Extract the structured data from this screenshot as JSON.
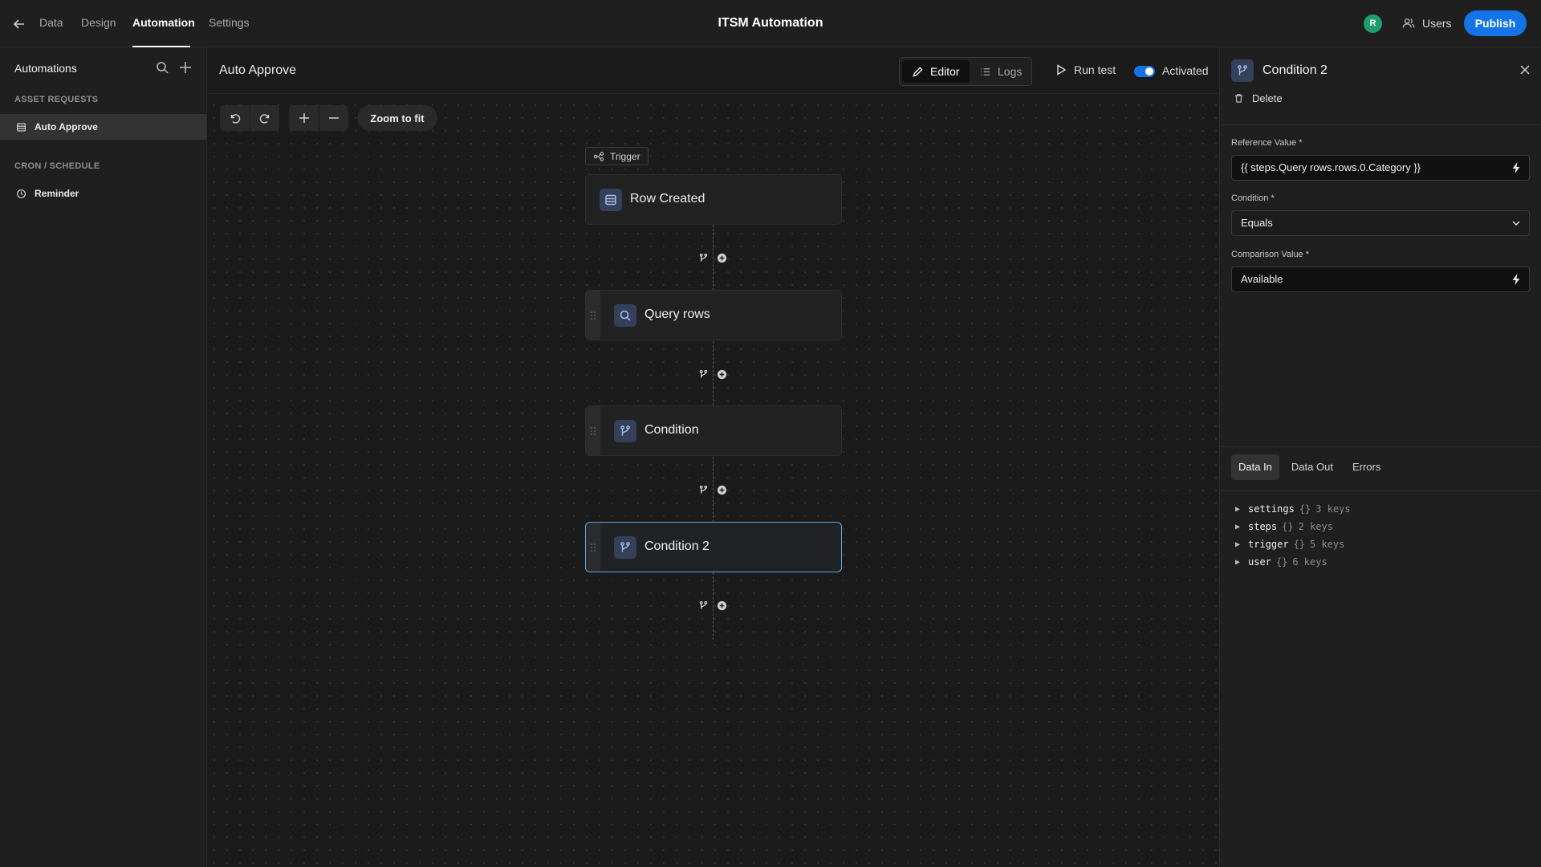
{
  "nav": {
    "tabs": [
      {
        "label": "Data"
      },
      {
        "label": "Design"
      },
      {
        "label": "Automation"
      },
      {
        "label": "Settings"
      }
    ],
    "app_title": "ITSM Automation",
    "avatar_initial": "R",
    "users_label": "Users",
    "publish_label": "Publish",
    "accent_color": "#1473e6"
  },
  "sidebar": {
    "title": "Automations",
    "sections": [
      {
        "label": "ASSET REQUESTS",
        "items": [
          {
            "label": "Auto Approve",
            "icon": "table-icon",
            "active": true
          }
        ]
      },
      {
        "label": "CRON / SCHEDULE",
        "items": [
          {
            "label": "Reminder",
            "icon": "clock-icon",
            "active": false
          }
        ]
      }
    ]
  },
  "canvas": {
    "automation_name": "Auto Approve",
    "editor_label": "Editor",
    "logs_label": "Logs",
    "run_test_label": "Run test",
    "activated_label": "Activated",
    "activated": true,
    "zoom_to_fit_label": "Zoom to fit",
    "trigger_chip_label": "Trigger",
    "nodes": [
      {
        "label": "Row Created",
        "icon": "table-icon",
        "selected": false
      },
      {
        "label": "Query rows",
        "icon": "search-icon",
        "selected": false
      },
      {
        "label": "Condition",
        "icon": "branch-icon",
        "selected": false
      },
      {
        "label": "Condition 2",
        "icon": "branch-icon",
        "selected": true
      }
    ]
  },
  "panel": {
    "title": "Condition 2",
    "delete_label": "Delete",
    "fields": {
      "reference_label": "Reference Value *",
      "reference_value": "{{ steps.Query rows.rows.0.Category }}",
      "condition_label": "Condition *",
      "condition_value": "Equals",
      "comparison_label": "Comparison Value *",
      "comparison_value": "Available"
    },
    "tabs": [
      {
        "label": "Data In",
        "active": true
      },
      {
        "label": "Data Out",
        "active": false
      },
      {
        "label": "Errors",
        "active": false
      }
    ],
    "tree": [
      {
        "key": "settings",
        "type": "{}",
        "count": "3 keys"
      },
      {
        "key": "steps",
        "type": "{}",
        "count": "2 keys"
      },
      {
        "key": "trigger",
        "type": "{}",
        "count": "5 keys"
      },
      {
        "key": "user",
        "type": "{}",
        "count": "6 keys"
      }
    ]
  }
}
